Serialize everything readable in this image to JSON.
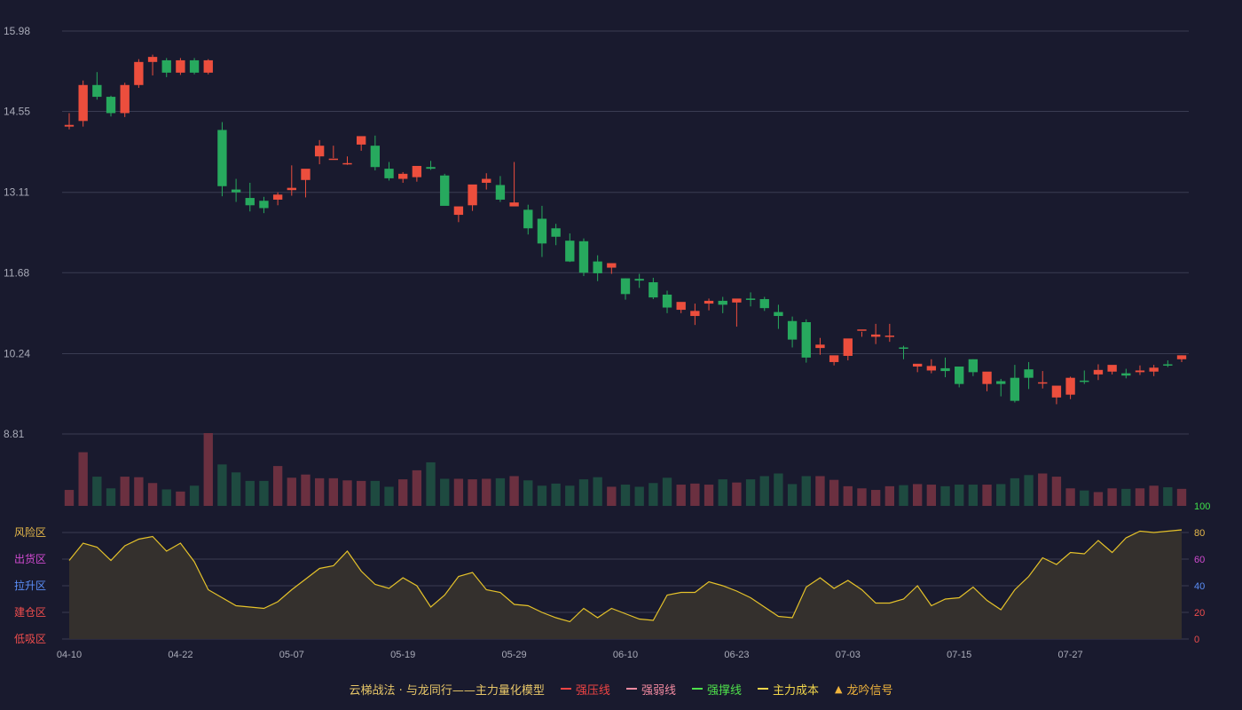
{
  "chart_data": [
    {
      "type": "candlestick",
      "name": "price",
      "y_ticks": [
        "15.98",
        "14.55",
        "13.11",
        "11.68",
        "10.24",
        "8.81"
      ],
      "y_tick_values": [
        15.98,
        14.55,
        13.11,
        11.68,
        10.24,
        8.81
      ],
      "ylim": [
        8.81,
        15.98
      ],
      "grid": true,
      "up_color": "#ec4e3d",
      "down_color": "#27a95e",
      "x": [
        "04-10",
        "04-11",
        "04-14",
        "04-15",
        "04-16",
        "04-17",
        "04-18",
        "04-21",
        "04-22",
        "04-23",
        "04-24",
        "04-25",
        "04-28",
        "04-29",
        "04-30",
        "05-06",
        "05-07",
        "05-08",
        "05-09",
        "05-12",
        "05-13",
        "05-14",
        "05-15",
        "05-16",
        "05-19",
        "05-20",
        "05-21",
        "05-22",
        "05-23",
        "05-26",
        "05-27",
        "05-28",
        "05-29",
        "05-30",
        "06-03",
        "06-04",
        "06-05",
        "06-06",
        "06-09",
        "06-10",
        "06-11",
        "06-12",
        "06-13",
        "06-16",
        "06-17",
        "06-18",
        "06-19",
        "06-20",
        "06-23",
        "06-24",
        "06-25",
        "06-26",
        "06-27",
        "06-30",
        "07-01",
        "07-02",
        "07-03",
        "07-04",
        "07-07",
        "07-08",
        "07-09",
        "07-10",
        "07-11",
        "07-14",
        "07-15",
        "07-16",
        "07-17",
        "07-18",
        "07-21",
        "07-22",
        "07-23",
        "07-24",
        "07-25",
        "07-28",
        "07-29",
        "07-30",
        "07-31",
        "08-01",
        "08-04",
        "08-05",
        "08-06"
      ],
      "open": [
        14.28,
        14.38,
        15.02,
        14.81,
        14.52,
        15.02,
        15.43,
        15.46,
        15.24,
        15.46,
        15.24,
        14.22,
        13.16,
        13.01,
        12.96,
        12.98,
        13.15,
        13.33,
        13.75,
        13.69,
        13.62,
        13.96,
        13.94,
        13.53,
        13.35,
        13.38,
        13.56,
        13.41,
        12.71,
        12.88,
        13.28,
        13.24,
        12.86,
        12.8,
        12.64,
        12.47,
        12.25,
        12.24,
        11.88,
        11.77,
        11.58,
        11.57,
        11.51,
        11.29,
        11.02,
        10.91,
        11.13,
        11.18,
        11.15,
        11.22,
        11.21,
        10.98,
        10.82,
        10.8,
        10.34,
        10.09,
        10.2,
        10.67,
        10.54,
        10.55,
        10.35,
        10.01,
        9.94,
        9.98,
        10.01,
        10.14,
        9.7,
        9.75,
        9.81,
        9.96,
        9.73,
        9.46,
        9.51,
        9.76,
        9.87,
        9.92,
        9.89,
        9.91,
        9.92,
        10.05,
        10.14
      ],
      "close": [
        14.31,
        15.02,
        14.81,
        14.52,
        15.02,
        15.43,
        15.52,
        15.24,
        15.46,
        15.24,
        15.46,
        13.22,
        13.11,
        12.88,
        12.83,
        13.07,
        13.19,
        13.53,
        13.94,
        13.71,
        13.63,
        14.11,
        13.56,
        13.36,
        13.44,
        13.58,
        13.53,
        12.87,
        12.86,
        13.25,
        13.35,
        12.98,
        12.93,
        12.47,
        12.2,
        12.32,
        11.88,
        11.68,
        11.67,
        11.85,
        11.3,
        11.54,
        11.24,
        11.06,
        11.16,
        11.0,
        11.18,
        11.11,
        11.22,
        11.2,
        11.05,
        10.91,
        10.49,
        10.17,
        10.4,
        10.21,
        10.51,
        10.67,
        10.58,
        10.56,
        10.33,
        10.06,
        10.02,
        9.93,
        9.7,
        9.91,
        9.92,
        9.7,
        9.4,
        9.81,
        9.73,
        9.67,
        9.81,
        9.74,
        9.95,
        10.04,
        9.85,
        9.94,
        9.99,
        10.04,
        10.21
      ],
      "high": [
        14.52,
        15.1,
        15.25,
        14.83,
        15.06,
        15.48,
        15.56,
        15.5,
        15.5,
        15.5,
        15.48,
        14.36,
        13.35,
        13.28,
        13.03,
        13.11,
        13.59,
        13.39,
        14.04,
        13.94,
        13.75,
        14.09,
        14.12,
        13.65,
        13.47,
        13.49,
        13.67,
        13.44,
        12.82,
        13.04,
        13.45,
        13.4,
        13.65,
        12.89,
        12.87,
        12.55,
        12.38,
        12.29,
        11.99,
        11.8,
        11.58,
        11.66,
        11.59,
        11.36,
        11.03,
        11.13,
        11.22,
        11.25,
        11.17,
        11.33,
        11.25,
        11.11,
        10.9,
        10.85,
        10.52,
        10.09,
        10.3,
        10.63,
        10.77,
        10.77,
        10.38,
        10.03,
        10.14,
        10.17,
        9.98,
        10.14,
        9.82,
        9.79,
        10.04,
        10.09,
        9.93,
        9.47,
        9.83,
        9.94,
        10.05,
        10.0,
        9.97,
        10.03,
        10.04,
        10.12,
        10.21
      ],
      "low": [
        14.23,
        14.28,
        14.76,
        14.46,
        14.45,
        14.97,
        15.19,
        15.16,
        15.2,
        15.21,
        15.21,
        13.04,
        12.94,
        12.77,
        12.74,
        12.88,
        13.05,
        13.02,
        13.61,
        13.72,
        13.6,
        13.85,
        13.5,
        13.32,
        13.28,
        13.3,
        13.51,
        12.95,
        12.58,
        12.78,
        13.16,
        12.94,
        12.92,
        12.36,
        11.96,
        12.17,
        11.87,
        11.62,
        11.53,
        11.66,
        11.2,
        11.41,
        11.21,
        10.96,
        10.96,
        10.75,
        11.01,
        10.96,
        10.72,
        11.08,
        11.0,
        10.68,
        10.35,
        10.08,
        10.22,
        10.03,
        10.12,
        10.54,
        10.41,
        10.45,
        10.14,
        9.91,
        9.89,
        9.82,
        9.64,
        9.84,
        9.57,
        9.48,
        9.37,
        9.61,
        9.62,
        9.34,
        9.43,
        9.7,
        9.77,
        9.87,
        9.8,
        9.86,
        9.84,
        10.0,
        10.09
      ]
    },
    {
      "type": "bar",
      "name": "volume",
      "values": [
        30,
        101,
        55,
        33,
        55,
        54,
        43,
        31,
        27,
        38,
        137,
        78,
        63,
        47,
        47,
        75,
        53,
        59,
        52,
        52,
        48,
        47,
        47,
        36,
        50,
        67,
        82,
        51,
        51,
        50,
        51,
        52,
        56,
        48,
        38,
        42,
        38,
        50,
        54,
        36,
        40,
        36,
        43,
        53,
        40,
        42,
        40,
        50,
        44,
        50,
        56,
        61,
        41,
        56,
        56,
        49,
        37,
        33,
        30,
        37,
        39,
        41,
        40,
        37,
        40,
        40,
        40,
        41,
        52,
        58,
        61,
        55,
        33,
        29,
        26,
        33,
        32,
        33,
        38,
        35,
        32,
        23
      ],
      "max_value": 137,
      "up_color": "#6b3040",
      "down_color": "#1e4a40"
    },
    {
      "type": "area",
      "name": "oscillator",
      "y_ticks": [
        "0",
        "20",
        "40",
        "60",
        "80",
        "100"
      ],
      "y_tick_values": [
        0,
        20,
        40,
        60,
        80,
        100
      ],
      "ylim": [
        0,
        100
      ],
      "y_tick_colors": [
        "#ef4d4d",
        "#ef4d4d",
        "#5b8ff9",
        "#d14bd1",
        "#e7b94a",
        "#3fe04b"
      ],
      "zone_labels": [
        "风险区",
        "出货区",
        "拉升区",
        "建仓区",
        "低吸区"
      ],
      "zone_label_values": [
        80,
        60,
        40,
        20,
        0
      ],
      "zone_colors": [
        "#e7b94a",
        "#d14bd1",
        "#5b8ff9",
        "#ef4d4d",
        "#ef4d4d"
      ],
      "x_ticks": [
        "04-10",
        "04-22",
        "05-07",
        "05-19",
        "05-29",
        "06-10",
        "06-23",
        "07-03",
        "07-15",
        "07-27"
      ],
      "x_tick_index": [
        0,
        8,
        16,
        24,
        32,
        40,
        48,
        56,
        64,
        72
      ],
      "line_color": "#e5c22a",
      "fill_color": "#34302d",
      "values": [
        59,
        72,
        69,
        59,
        70,
        75,
        77,
        66,
        72,
        58,
        37,
        31,
        25,
        24,
        23,
        28,
        37,
        45,
        53,
        55,
        66,
        51,
        41,
        38,
        46,
        40,
        24,
        33,
        47,
        50,
        37,
        35,
        26,
        25,
        20,
        16,
        13,
        23,
        16,
        23,
        19,
        15,
        14,
        33,
        35,
        35,
        43,
        40,
        36,
        31,
        24,
        17,
        16,
        39,
        46,
        38,
        44,
        37,
        27,
        27,
        30,
        40,
        25,
        30,
        31,
        39,
        29,
        22,
        37,
        47,
        61,
        56,
        65,
        64,
        74,
        65,
        76,
        81,
        80,
        81,
        82
      ]
    }
  ],
  "legend": {
    "title": "云梯战法 · 与龙同行——主力量化模型",
    "items": [
      {
        "label": "强压线",
        "color": "#ef4444",
        "style": "solid"
      },
      {
        "label": "强弱线",
        "color": "#f28aa0",
        "style": "dashed"
      },
      {
        "label": "强撑线",
        "color": "#4ee04b",
        "style": "solid"
      },
      {
        "label": "主力成本",
        "color": "#f1d54a",
        "style": "dashed"
      },
      {
        "label": "龙吟信号",
        "color": "#f0b43c",
        "style": "triangle",
        "glyph": "▲"
      }
    ]
  },
  "colors": {
    "background": "#191a2e",
    "grid": "#3a3c52",
    "axis_text": "#a9abb8"
  }
}
